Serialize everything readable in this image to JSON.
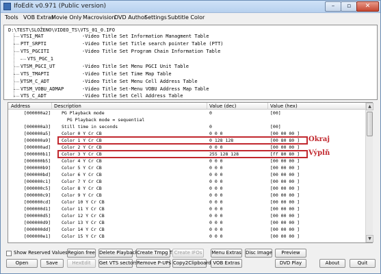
{
  "window": {
    "title": "IfoEdit v0.971 (Public version)",
    "controls": {
      "minimize": "–",
      "maximize": "▫",
      "close": "✕"
    }
  },
  "menu": [
    "Tools",
    "VOB Extras",
    "Movie Only",
    "Macrovision",
    "DVD Author",
    "Settings",
    "Subtitle Color"
  ],
  "tree": {
    "root": "D:\\TEST\\SLOŽENO\\VIDEO_TS\\VTS_01_0.IFO",
    "items": [
      {
        "name": "VTSI_MAT",
        "desc": "-Video Title Set Information Managment Table"
      },
      {
        "name": "PTT_SRPTI",
        "desc": "-Video Title Set Title search pointer Table (PTT)"
      },
      {
        "name": "VTS_PGCITI",
        "desc": "-Video Title Set Program Chain Information Table"
      },
      {
        "name": "VTS_PGC_1",
        "desc": ""
      },
      {
        "name": "VTSM_PGCI_UT",
        "desc": "-Video Title Set Menu PGCI Unit Table"
      },
      {
        "name": "VTS_TMAPTI",
        "desc": "-Video Title Set Time Map Table"
      },
      {
        "name": "VTSM_C_ADT",
        "desc": "-Video Title Set Menu Cell Address Table"
      },
      {
        "name": "VTSM_VOBU_ADMAP",
        "desc": "-Video Title Set-Menu VOBU Address Map Table"
      },
      {
        "name": "VTS_C_ADT",
        "desc": "-Video Title Set Cell Address Table"
      }
    ]
  },
  "table": {
    "columns": [
      "Address",
      "Description",
      "Value (dec)",
      "Value (hex)"
    ],
    "rows": [
      {
        "addr": "[000000a2]",
        "desc": "PG Playback mode",
        "dec": "0",
        "hex": "[00]"
      },
      {
        "addr": "",
        "desc": "  PG Playback mode = sequential",
        "dec": "",
        "hex": ""
      },
      {
        "addr": "[000000a3]",
        "desc": "Still time in seconds",
        "dec": "0",
        "hex": "[00]"
      },
      {
        "addr": "[000000a5]",
        "desc": "Color 0 Y Cr CB",
        "dec": "0 0 0",
        "hex": "[00 00 00 ]"
      },
      {
        "addr": "[000000a9]",
        "desc": "Color 1 Y Cr CB",
        "dec": "0 128 128",
        "hex": "[00 80 80 ]"
      },
      {
        "addr": "[000000ad]",
        "desc": "Color 2 Y Cr CB",
        "dec": "0 0 0",
        "hex": "[00 00 00 ]"
      },
      {
        "addr": "[000000b1]",
        "desc": "Color 3 Y Cr CB",
        "dec": "255 128 128",
        "hex": "[ff 80 80 ]"
      },
      {
        "addr": "[000000b5]",
        "desc": "Color 4 Y Cr CB",
        "dec": "0 0 0",
        "hex": "[00 00 00 ]"
      },
      {
        "addr": "[000000b9]",
        "desc": "Color 5 Y Cr CB",
        "dec": "0 0 0",
        "hex": "[00 00 00 ]"
      },
      {
        "addr": "[000000bd]",
        "desc": "Color 6 Y Cr CB",
        "dec": "0 0 0",
        "hex": "[00 00 00 ]"
      },
      {
        "addr": "[000000c1]",
        "desc": "Color 7 Y Cr CB",
        "dec": "0 0 0",
        "hex": "[00 00 00 ]"
      },
      {
        "addr": "[000000c5]",
        "desc": "Color 8 Y Cr CB",
        "dec": "0 0 0",
        "hex": "[00 00 00 ]"
      },
      {
        "addr": "[000000c9]",
        "desc": "Color 9 Y Cr CB",
        "dec": "0 0 0",
        "hex": "[00 00 00 ]"
      },
      {
        "addr": "[000000cd]",
        "desc": "Color 10 Y Cr CB",
        "dec": "0 0 0",
        "hex": "[00 00 00 ]"
      },
      {
        "addr": "[000000d1]",
        "desc": "Color 11 Y Cr CB",
        "dec": "0 0 0",
        "hex": "[00 00 00 ]"
      },
      {
        "addr": "[000000d5]",
        "desc": "Color 12 Y Cr CB",
        "dec": "0 0 0",
        "hex": "[00 00 00 ]"
      },
      {
        "addr": "[000000d9]",
        "desc": "Color 13 Y Cr CB",
        "dec": "0 0 0",
        "hex": "[00 00 00 ]"
      },
      {
        "addr": "[000000dd]",
        "desc": "Color 14 Y Cr CB",
        "dec": "0 0 0",
        "hex": "[00 00 00 ]"
      },
      {
        "addr": "[000000e1]",
        "desc": "Color 15 Y Cr CB",
        "dec": "0 0 0",
        "hex": "[00 00 00 ]"
      }
    ]
  },
  "annotations": {
    "okraj": "Okraj",
    "vypln": "Výplň",
    "color": "#c1272d"
  },
  "controls": {
    "show_reserved": "Show Reserved Values",
    "region_free": "Region free",
    "delete_playback": "Delete Playback",
    "create_tmpg": "Create Tmpg T.",
    "create_ifos": "Create IFOs",
    "menu_extras": "Menu Extras",
    "disc_image": "Disc Image",
    "preview": "Preview",
    "open": "Open",
    "save": "Save",
    "hexedit": "HexEdit",
    "get_vts_sectors": "Get VTS sectors",
    "remove_pups": "Remove P-UPs",
    "copy2clipboard": "Copy2Clipboard",
    "vob_extras": "VOB Extras",
    "dvd_play": "DVD Play",
    "about": "About",
    "quit": "Quit"
  }
}
